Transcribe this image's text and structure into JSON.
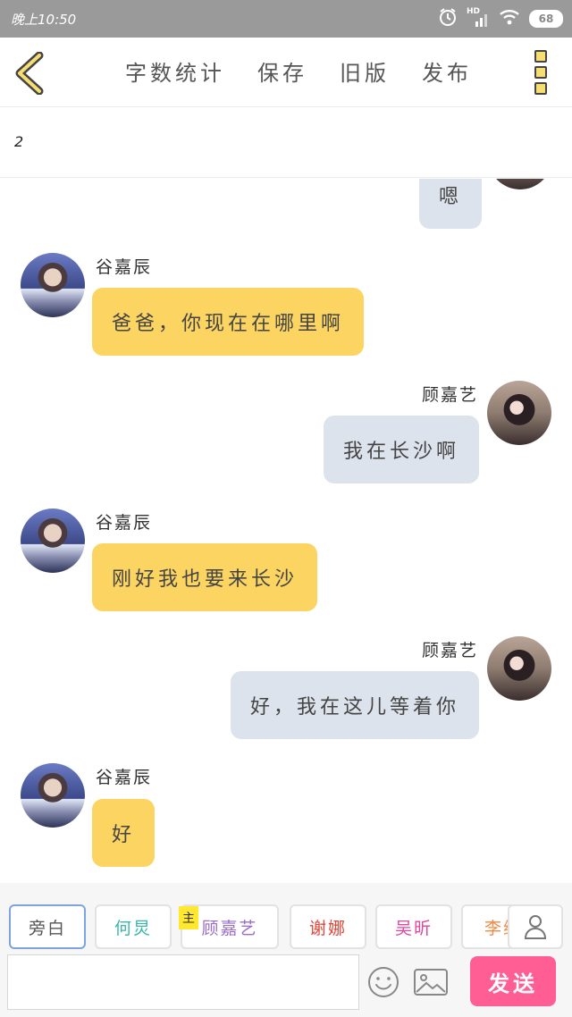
{
  "status_bar": {
    "time": "晚上10:50",
    "network": "HD",
    "battery": "68"
  },
  "nav": {
    "actions": [
      "字数统计",
      "保存",
      "旧版",
      "发布"
    ]
  },
  "title": {
    "text": "2"
  },
  "messages": [
    {
      "side": "right",
      "sender": "",
      "text": "嗯"
    },
    {
      "side": "left",
      "sender": "谷嘉辰",
      "text": "爸爸，你现在在哪里啊"
    },
    {
      "side": "right",
      "sender": "顾嘉艺",
      "text": "我在长沙啊"
    },
    {
      "side": "left",
      "sender": "谷嘉辰",
      "text": "刚好我也要来长沙"
    },
    {
      "side": "right",
      "sender": "顾嘉艺",
      "text": "好，我在这儿等着你"
    },
    {
      "side": "left",
      "sender": "谷嘉辰",
      "text": "好"
    }
  ],
  "roles": {
    "tabs": [
      {
        "label": "旁白",
        "color": "#555555"
      },
      {
        "label": "何炅",
        "color": "#3cb7a8"
      },
      {
        "label": "顾嘉艺",
        "color": "#9b6fc8"
      },
      {
        "label": "谢娜",
        "color": "#e0463b"
      },
      {
        "label": "吴昕",
        "color": "#e0479e"
      },
      {
        "label": "李维",
        "color": "#f28a44"
      }
    ],
    "main_badge": "主"
  },
  "input": {
    "value": "",
    "send_label": "发送"
  }
}
